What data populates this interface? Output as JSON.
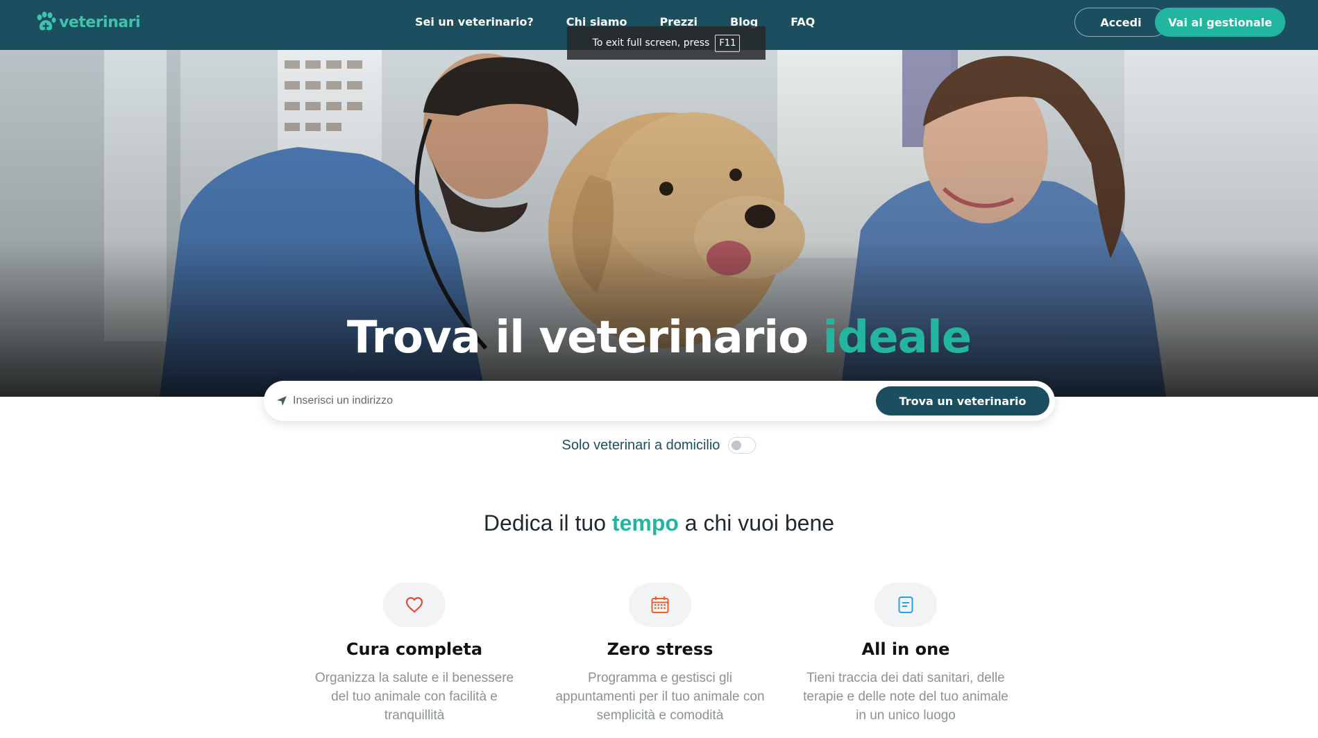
{
  "header": {
    "logo_text": "veterinari",
    "nav": [
      {
        "label": "Sei un veterinario?"
      },
      {
        "label": "Chi siamo"
      },
      {
        "label": "Prezzi"
      },
      {
        "label": "Blog"
      },
      {
        "label": "FAQ"
      }
    ],
    "login_label": "Accedi",
    "cta_label": "Vai al gestionale"
  },
  "fullscreen_notice": {
    "text": "To exit full screen, press",
    "key": "F11"
  },
  "hero": {
    "title_main": "Trova il veterinario",
    "title_accent": "ideale"
  },
  "search": {
    "placeholder": "Inserisci un indirizzo",
    "button_label": "Trova un veterinario"
  },
  "home_visit_toggle": {
    "label": "Solo veterinari a domicilio",
    "state": "off"
  },
  "section": {
    "title_before": "Dedica il tuo",
    "title_accent": "tempo",
    "title_after": "a chi vuoi bene"
  },
  "features": [
    {
      "icon": "heart-icon",
      "title": "Cura completa",
      "description": "Organizza la salute e il benessere del tuo animale con facilità e tranquillità",
      "icon_color": "#e04b3f"
    },
    {
      "icon": "calendar-icon",
      "title": "Zero stress",
      "description": "Programma e gestisci gli appuntamenti per il tuo animale con semplicità e comodità",
      "icon_color": "#e8602f"
    },
    {
      "icon": "note-icon",
      "title": "All in one",
      "description": "Tieni traccia dei dati sanitari, delle terapie e delle note del tuo animale in un unico luogo",
      "icon_color": "#2a9fd6"
    }
  ],
  "colors": {
    "brand_dark": "#1b4e5f",
    "accent": "#24b59f"
  }
}
